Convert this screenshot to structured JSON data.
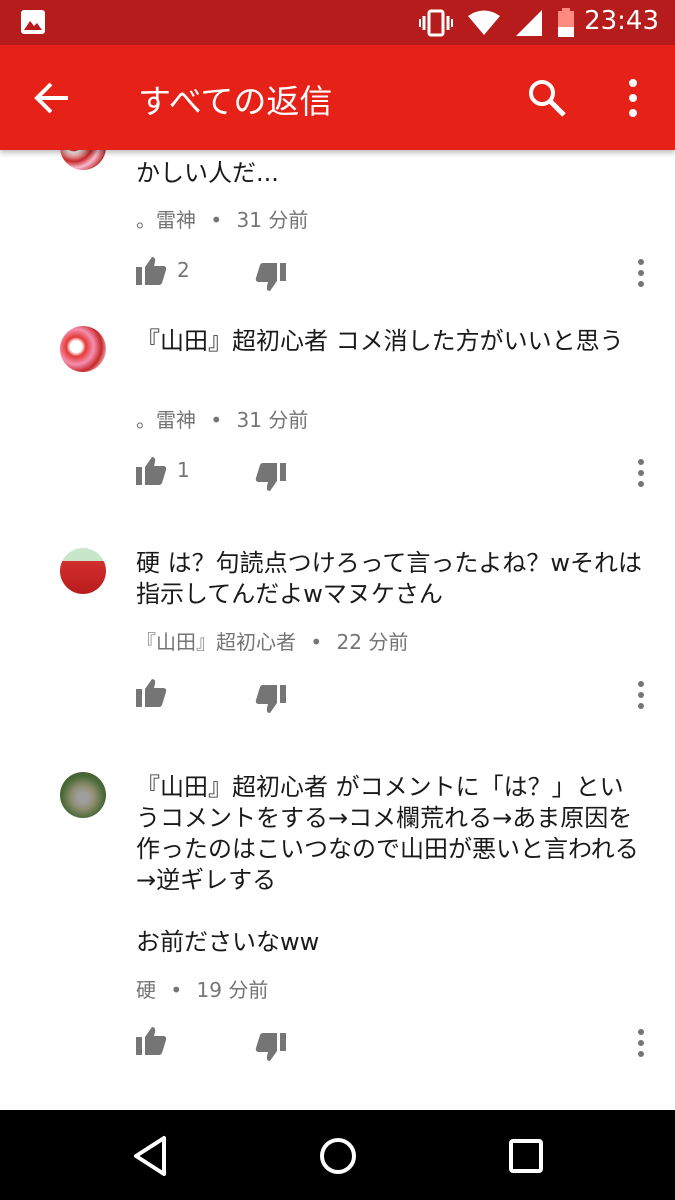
{
  "status_bar": {
    "time": "23:43",
    "icons": [
      "gallery-icon",
      "vibrate-icon",
      "wifi-icon",
      "signal-icon",
      "battery-icon"
    ],
    "background": "#b71c1c"
  },
  "app_bar": {
    "title": "すべての返信",
    "background": "#e62117",
    "icons": [
      "back-arrow-icon",
      "search-icon",
      "more-vert-icon"
    ]
  },
  "comments": [
    {
      "text": "かしい人だ...",
      "author": "。雷神",
      "time": "31 分前",
      "likes": "2",
      "separator": "•"
    },
    {
      "text": "『山田』超初心者 コメ消した方がいいと思う",
      "author": "。雷神",
      "time": "31 分前",
      "likes": "1",
      "separator": "•"
    },
    {
      "text": "硬 は？句読点つけろって言ったよね？wそれは指示してんだよwマヌケさん",
      "author": "『山田』超初心者",
      "time": "22 分前",
      "likes": "",
      "separator": "•"
    },
    {
      "text": "『山田』超初心者 がコメントに「は？」というコメントをする→コメ欄荒れる→あま原因を作ったのはこいつなので山田が悪いと言われる→逆ギレする\n\nお前ださいなww",
      "author": "硬",
      "time": "19 分前",
      "likes": "",
      "separator": "•"
    }
  ],
  "nav_bar": {
    "icons": [
      "nav-back-icon",
      "nav-home-icon",
      "nav-recents-icon"
    ]
  }
}
